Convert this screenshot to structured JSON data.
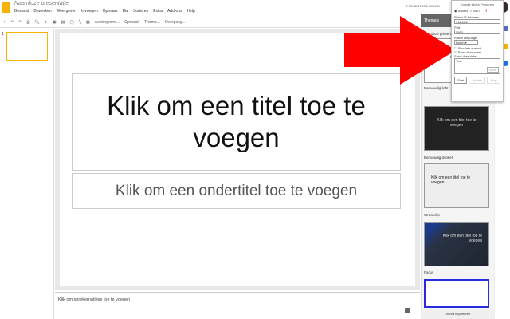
{
  "app": {
    "title": "Naamloze presentatie",
    "menu": [
      "Bestand",
      "Bewerken",
      "Weergeven",
      "Invoegen",
      "Opmaak",
      "Dia",
      "Sorteren",
      "Extra",
      "Add-ons",
      "Help"
    ]
  },
  "toolbar": {
    "items": [
      "Achtergrond...",
      "Opmaak",
      "Thema...",
      "Overgang..."
    ]
  },
  "filmstrip": {
    "slide_number": "1"
  },
  "slide": {
    "title": "Klik om een titel toe te voegen",
    "subtitle": "Klik om een ondertitel toe te voegen"
  },
  "notes": {
    "placeholder": "Klik om sprekernotities toe te voegen"
  },
  "share": {
    "label": "PRESENTATIE DELEN"
  },
  "themes": {
    "tab": "Thema's",
    "section": "In deze presentatie",
    "items": [
      {
        "label": "Eenvoudig licht",
        "preview": "Klik om een titel toe te voegen"
      },
      {
        "label": "Eenvoudig donker",
        "preview": "Klik om een titel toe te voegen"
      },
      {
        "label": "Streamlijn",
        "preview": "Klik om een titel toe te voegen"
      },
      {
        "label": "Focus",
        "preview": "Klik om een titel toe te voegen"
      }
    ],
    "import_button": "Thema importeren"
  },
  "popup": {
    "title": "Google slides Presenter",
    "radio_socket": "Socket",
    "radio_mqtt": "MQTT",
    "ip_label": "Robot IP Address",
    "ip_value": "192.168.",
    "port_label": "Port",
    "port_value": "5560",
    "lang_label": "Robot language",
    "lang_value": "Dutch",
    "check_simulate": "Simulate speech",
    "check_notes": "Read slide notes",
    "send_label": "Send data-data:",
    "send_value": "Test",
    "send_button": "Send",
    "start_button": "Start",
    "update_button": "Update",
    "stop_button": "Stop"
  },
  "colors": {
    "arrow": "#ff0000",
    "accent": "#f4b400"
  }
}
